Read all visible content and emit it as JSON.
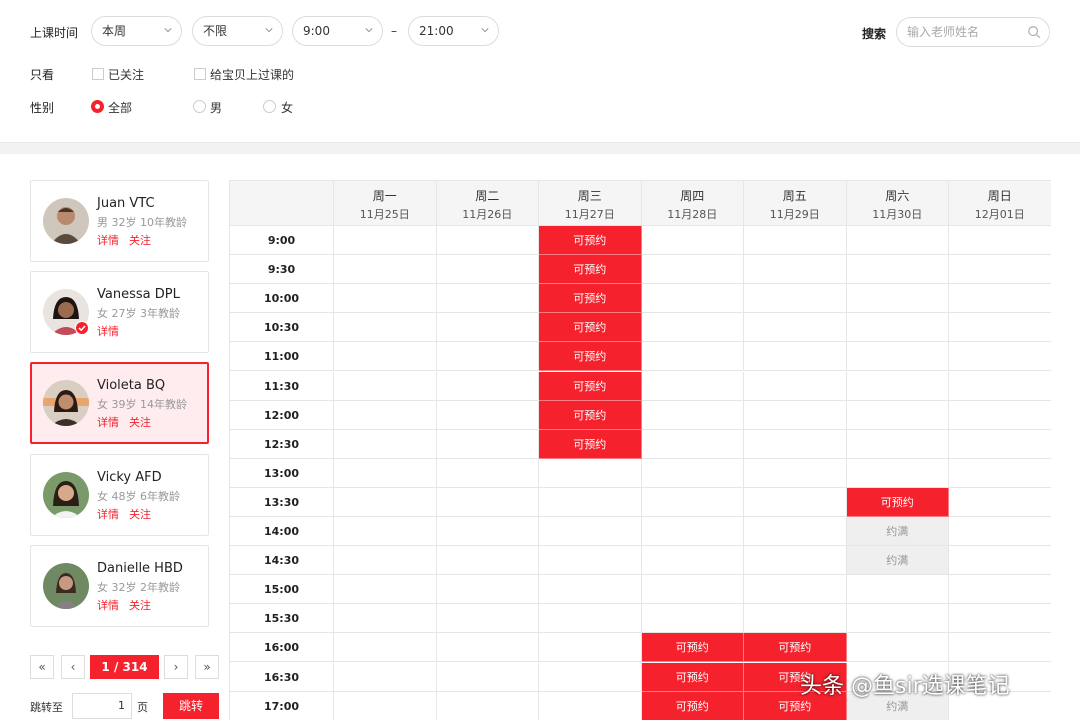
{
  "filters": {
    "time_label": "上课时间",
    "week_select": "本周",
    "range_select": "不限",
    "start_time": "9:00",
    "dash": "–",
    "end_time": "21:00",
    "search_label": "搜索",
    "search_placeholder": "输入老师姓名",
    "only_label": "只看",
    "followed_label": "已关注",
    "taught_label": "给宝贝上过课的",
    "gender_label": "性别",
    "gender_all": "全部",
    "gender_male": "男",
    "gender_female": "女"
  },
  "teachers": [
    {
      "name": "Juan VTC",
      "meta": "男 32岁 10年教龄",
      "detail": "详情",
      "follow": "关注",
      "selected": false
    },
    {
      "name": "Vanessa DPL",
      "meta": "女 27岁 3年教龄",
      "detail": "详情",
      "follow": "",
      "selected": false,
      "followed": true
    },
    {
      "name": "Violeta BQ",
      "meta": "女 39岁 14年教龄",
      "detail": "详情",
      "follow": "关注",
      "selected": true
    },
    {
      "name": "Vicky AFD",
      "meta": "女 48岁 6年教龄",
      "detail": "详情",
      "follow": "关注",
      "selected": false
    },
    {
      "name": "Danielle HBD",
      "meta": "女 32岁 2年教龄",
      "detail": "详情",
      "follow": "关注",
      "selected": false
    }
  ],
  "pagination": {
    "first": "«",
    "prev": "‹",
    "current": "1 / 314",
    "next": "›",
    "last": "»",
    "jump_label": "跳转至",
    "jump_value": "1",
    "page_unit": "页",
    "jump_button": "跳转"
  },
  "schedule": {
    "days": [
      {
        "day": "周一",
        "date": "11月25日"
      },
      {
        "day": "周二",
        "date": "11月26日"
      },
      {
        "day": "周三",
        "date": "11月27日"
      },
      {
        "day": "周四",
        "date": "11月28日"
      },
      {
        "day": "周五",
        "date": "11月29日"
      },
      {
        "day": "周六",
        "date": "11月30日"
      },
      {
        "day": "周日",
        "date": "12月01日"
      }
    ],
    "times": [
      "9:00",
      "9:30",
      "10:00",
      "10:30",
      "11:00",
      "11:30",
      "12:00",
      "12:30",
      "13:00",
      "13:30",
      "14:00",
      "14:30",
      "15:00",
      "15:30",
      "16:00",
      "16:30",
      "17:00"
    ],
    "available_label": "可预约",
    "full_label": "约满",
    "slots": [
      {
        "time": "9:00",
        "day": 2,
        "status": "available"
      },
      {
        "time": "9:30",
        "day": 2,
        "status": "available"
      },
      {
        "time": "10:00",
        "day": 2,
        "status": "available"
      },
      {
        "time": "10:30",
        "day": 2,
        "status": "available"
      },
      {
        "time": "11:00",
        "day": 2,
        "status": "available"
      },
      {
        "time": "11:30",
        "day": 2,
        "status": "available"
      },
      {
        "time": "12:00",
        "day": 2,
        "status": "available"
      },
      {
        "time": "12:30",
        "day": 2,
        "status": "available"
      },
      {
        "time": "13:30",
        "day": 5,
        "status": "available"
      },
      {
        "time": "14:00",
        "day": 5,
        "status": "full"
      },
      {
        "time": "14:30",
        "day": 5,
        "status": "full"
      },
      {
        "time": "16:00",
        "day": 3,
        "status": "available"
      },
      {
        "time": "16:00",
        "day": 4,
        "status": "available"
      },
      {
        "time": "16:30",
        "day": 3,
        "status": "available"
      },
      {
        "time": "16:30",
        "day": 4,
        "status": "available"
      },
      {
        "time": "17:00",
        "day": 3,
        "status": "available"
      },
      {
        "time": "17:00",
        "day": 4,
        "status": "available"
      },
      {
        "time": "17:00",
        "day": 5,
        "status": "full"
      }
    ]
  },
  "watermark": "头条 @鱼sir选课笔记",
  "colors": {
    "accent": "#f5222d",
    "full_bg": "#efefef",
    "header_bg": "#f5f5f5"
  }
}
